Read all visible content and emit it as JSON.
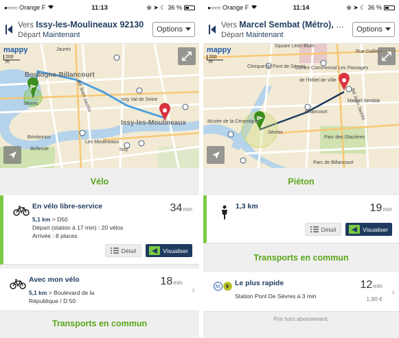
{
  "left": {
    "status": {
      "carrier": "Orange F",
      "time": "11:13",
      "battery": "36 %"
    },
    "header": {
      "to_prefix": "Vers",
      "destination": "Issy-les-Moulineaux 92130",
      "depart_prefix": "Départ",
      "depart_value": "Maintenant",
      "options_label": "Options"
    },
    "map": {
      "logo": "mappy",
      "scale": "200 m",
      "labels": {
        "boulogne": "Boulogne-Billancourt",
        "issy": "Issy-les-Moulineaux",
        "jean_jaures": "Bd Jean Jaurès",
        "les_moulineaux": "Les Moulineaux",
        "brimbon": "Brimborion",
        "bellevue": "Bellevue",
        "sevres": "Sèvres",
        "issy_val": "Issy Val de Seine",
        "issy_small": "Issy",
        "jaures": "Jaurès"
      }
    },
    "section_velo": "Vélo",
    "velo_libre": {
      "title": "En vélo libre-service",
      "distance": "5,1 km",
      "route": "D50",
      "depart": "Départ (station à 17 min) : 20 vélos",
      "arrivee": "Arrivée : 8 places",
      "duration": "34",
      "unit": "min",
      "detail_label": "Détail",
      "visual_label": "Visualiser"
    },
    "velo_perso": {
      "title": "Avec mon vélo",
      "distance": "5,1 km",
      "route": "Boulevard de la",
      "route2": "République / D 50",
      "duration": "18",
      "unit": "min"
    },
    "section_transport": "Transports en commun"
  },
  "right": {
    "status": {
      "carrier": "Orange F",
      "time": "11:14",
      "battery": "36 %"
    },
    "header": {
      "to_prefix": "Vers",
      "destination": "Marcel Sembat (Métro), 92...",
      "depart_prefix": "Départ",
      "depart_value": "Maintenant",
      "options_label": "Options"
    },
    "map": {
      "logo": "mappy",
      "scale": "200 m",
      "labels": {
        "square": "Square Léon Blum",
        "clinique": "Clinique du Pont de Sèvres",
        "centre": "Centre Commercial Les Passages",
        "hotel": "de l'Hôtel de Ville",
        "parc_glacieres": "Parc des Glacières",
        "billancourt": "Billancourt",
        "jean_jaures": "Bd Jean Jaurès",
        "sembat": "Marcel Sembat",
        "gallieni": "Rue Gallieni",
        "ceramique": "Musée de la Céramique",
        "sevres": "Sèvres",
        "parc_billancourt": "Parc de Billancourt"
      }
    },
    "section_pieton": "Piéton",
    "pieton": {
      "distance": "1,3 km",
      "duration": "19",
      "unit": "min",
      "detail_label": "Détail",
      "visual_label": "Visualiser"
    },
    "section_transport": "Transports en commun",
    "transport": {
      "title": "Le plus rapide",
      "line_m": "M",
      "line_9": "9",
      "station": "Station Pont De Sèvres à 3 min",
      "duration": "12",
      "unit": "min",
      "price": "1,90 €"
    },
    "footnote": "Prix hors abonnement."
  }
}
